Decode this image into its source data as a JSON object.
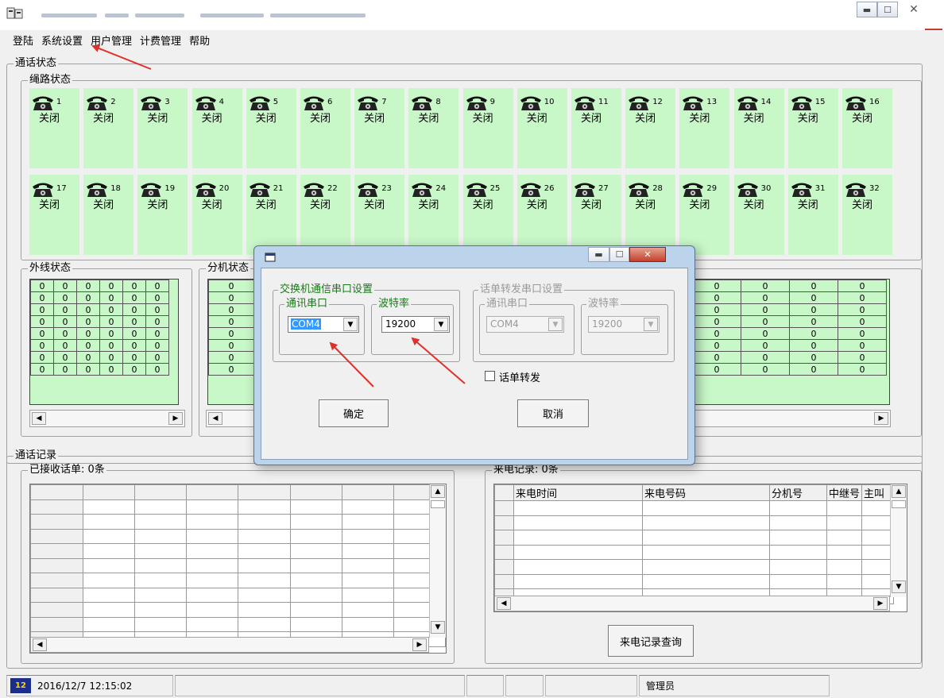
{
  "menu": [
    "登陆",
    "系统设置",
    "用户管理",
    "计费管理",
    "帮助"
  ],
  "groups": {
    "call_status": "通话状态",
    "trunk_status": "绳路状态",
    "outside_status": "外线状态",
    "extension_status": "分机状态",
    "call_records": "通话记录",
    "received_bills": "已接收话单: 0条",
    "incoming_records": "来电记录: 0条"
  },
  "lines": [
    {
      "num": "1",
      "status": "关闭"
    },
    {
      "num": "2",
      "status": "关闭"
    },
    {
      "num": "3",
      "status": "关闭"
    },
    {
      "num": "4",
      "status": "关闭"
    },
    {
      "num": "5",
      "status": "关闭"
    },
    {
      "num": "6",
      "status": "关闭"
    },
    {
      "num": "7",
      "status": "关闭"
    },
    {
      "num": "8",
      "status": "关闭"
    },
    {
      "num": "9",
      "status": "关闭"
    },
    {
      "num": "10",
      "status": "关闭"
    },
    {
      "num": "11",
      "status": "关闭"
    },
    {
      "num": "12",
      "status": "关闭"
    },
    {
      "num": "13",
      "status": "关闭"
    },
    {
      "num": "14",
      "status": "关闭"
    },
    {
      "num": "15",
      "status": "关闭"
    },
    {
      "num": "16",
      "status": "关闭"
    },
    {
      "num": "17",
      "status": "关闭"
    },
    {
      "num": "18",
      "status": "关闭"
    },
    {
      "num": "19",
      "status": "关闭"
    },
    {
      "num": "20",
      "status": "关闭"
    },
    {
      "num": "21",
      "status": "关闭"
    },
    {
      "num": "22",
      "status": "关闭"
    },
    {
      "num": "23",
      "status": "关闭"
    },
    {
      "num": "24",
      "status": "关闭"
    },
    {
      "num": "25",
      "status": "关闭"
    },
    {
      "num": "26",
      "status": "关闭"
    },
    {
      "num": "27",
      "status": "关闭"
    },
    {
      "num": "28",
      "status": "关闭"
    },
    {
      "num": "29",
      "status": "关闭"
    },
    {
      "num": "30",
      "status": "关闭"
    },
    {
      "num": "31",
      "status": "关闭"
    },
    {
      "num": "32",
      "status": "关闭"
    }
  ],
  "cell_value": "0",
  "incoming_headers": [
    "来电时间",
    "来电号码",
    "分机号",
    "中继号",
    "主叫"
  ],
  "incoming_query_button": "来电记录查询",
  "statusbar": {
    "datetime": "2016/12/7 12:15:02",
    "user": "管理员"
  },
  "dialog": {
    "switch_group": "交换机通信串口设置",
    "port_label": "通讯串口",
    "baud_label": "波特率",
    "port_value": "COM4",
    "baud_value": "19200",
    "forward_group": "话单转发串口设置",
    "forward_port_label": "通讯串口",
    "forward_baud_label": "波特率",
    "forward_port_value": "COM4",
    "forward_baud_value": "19200",
    "forward_checkbox": "话单转发",
    "ok_button": "确定",
    "cancel_button": "取消"
  },
  "colors": {
    "tile_green": "#c8f7c8",
    "annotation_red": "#e0302a",
    "dialog_title_green": "#1a7a1a",
    "selection_blue": "#3399ff"
  }
}
